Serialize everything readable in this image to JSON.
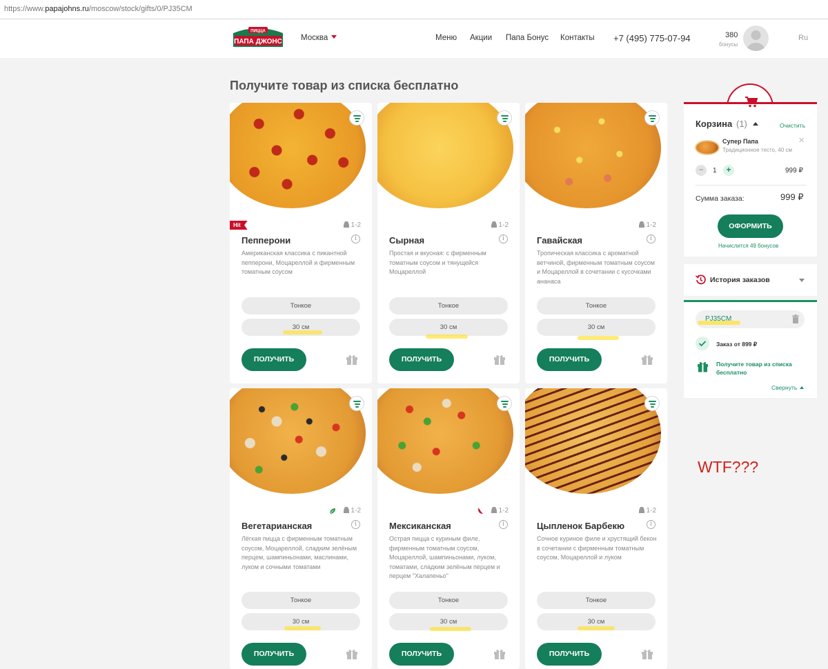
{
  "browser": {
    "url_prefix": "https://www.",
    "url_domain": "papajohns.ru",
    "url_path": "/moscow/stock/gifts/0/PJ35CM"
  },
  "header": {
    "logo_top": "ПИЦЦА",
    "logo_main": "ПАПА ДЖОНС",
    "city": "Москва",
    "nav": [
      "Меню",
      "Акции",
      "Папа Бонус",
      "Контакты"
    ],
    "phone": "+7 (495) 775-07-94",
    "bonus_count": "380",
    "bonus_label": "бонусы",
    "lang": "Ru"
  },
  "page_title": "Получите товар из списка бесплатно",
  "products": [
    {
      "name": "Пепперони",
      "desc": "Американская классика с пикантной пепперони, Моцареллой и фирменным томатным соусом",
      "persons": "1-2",
      "hit": "Hit",
      "dough": "Тонкое",
      "size": "30 см",
      "button": "ПОЛУЧИТЬ",
      "badge": ""
    },
    {
      "name": "Сырная",
      "desc": "Простая и вкусная: с фирменным томатным соусом и тянущейся Моцареллой",
      "persons": "1-2",
      "hit": "",
      "dough": "Тонкое",
      "size": "30 см",
      "button": "ПОЛУЧИТЬ",
      "badge": ""
    },
    {
      "name": "Гавайская",
      "desc": "Тропическая классика с ароматной ветчиной, фирменным томатным соусом и Моцареллой в сочетании с кусочками ананаса",
      "persons": "1-2",
      "hit": "",
      "dough": "Тонкое",
      "size": "30 см",
      "button": "ПОЛУЧИТЬ",
      "badge": ""
    },
    {
      "name": "Вегетарианская",
      "desc": "Лёгкая пицца с фирменным томатным соусом, Моцареллой, сладким зелёным перцем, шампиньонами, маслинами, луком и сочными томатами",
      "persons": "1-2",
      "hit": "",
      "dough": "Тонкое",
      "size": "30 см",
      "button": "ПОЛУЧИТЬ",
      "badge": "leaf-icon"
    },
    {
      "name": "Мексиканская",
      "desc": "Острая пицца с куриным филе, фирменным томатным соусом, Моцареллой, шампиньонами, луком, томатами, сладким зелёным перцем и перцем \"Халапеньо\"",
      "persons": "1-2",
      "hit": "",
      "dough": "Тонкое",
      "size": "30 см",
      "button": "ПОЛУЧИТЬ",
      "badge": "chili-icon"
    },
    {
      "name": "Цыпленок Барбекю",
      "desc": "Сочное куриное филе и хрустящий бекон в сочетании с фирменным томатным соусом, Моцареллой и луком",
      "persons": "1-2",
      "hit": "",
      "dough": "Тонкое",
      "size": "30 см",
      "button": "ПОЛУЧИТЬ",
      "badge": ""
    }
  ],
  "cart": {
    "title": "Корзина",
    "count": "(1)",
    "clear": "Очистить",
    "item_name": "Супер Папа",
    "item_desc": "Традиционное тесто, 40 см",
    "qty": "1",
    "item_price": "999 ₽",
    "sum_label": "Сумма заказа:",
    "sum_value": "999 ₽",
    "checkout": "ОФОРМИТЬ",
    "bonus_note": "Начислится 49 бонусов"
  },
  "history": {
    "label": "История заказов"
  },
  "promo": {
    "code": "PJ35CM",
    "condition": "Заказ от 899 ₽",
    "message": "Получите товар из списка бесплатно",
    "collapse": "Свернуть"
  },
  "annotation": "WTF???",
  "colors": {
    "brand_green": "#157e5a",
    "brand_red": "#c9102b",
    "highlight": "#ffe13c"
  }
}
